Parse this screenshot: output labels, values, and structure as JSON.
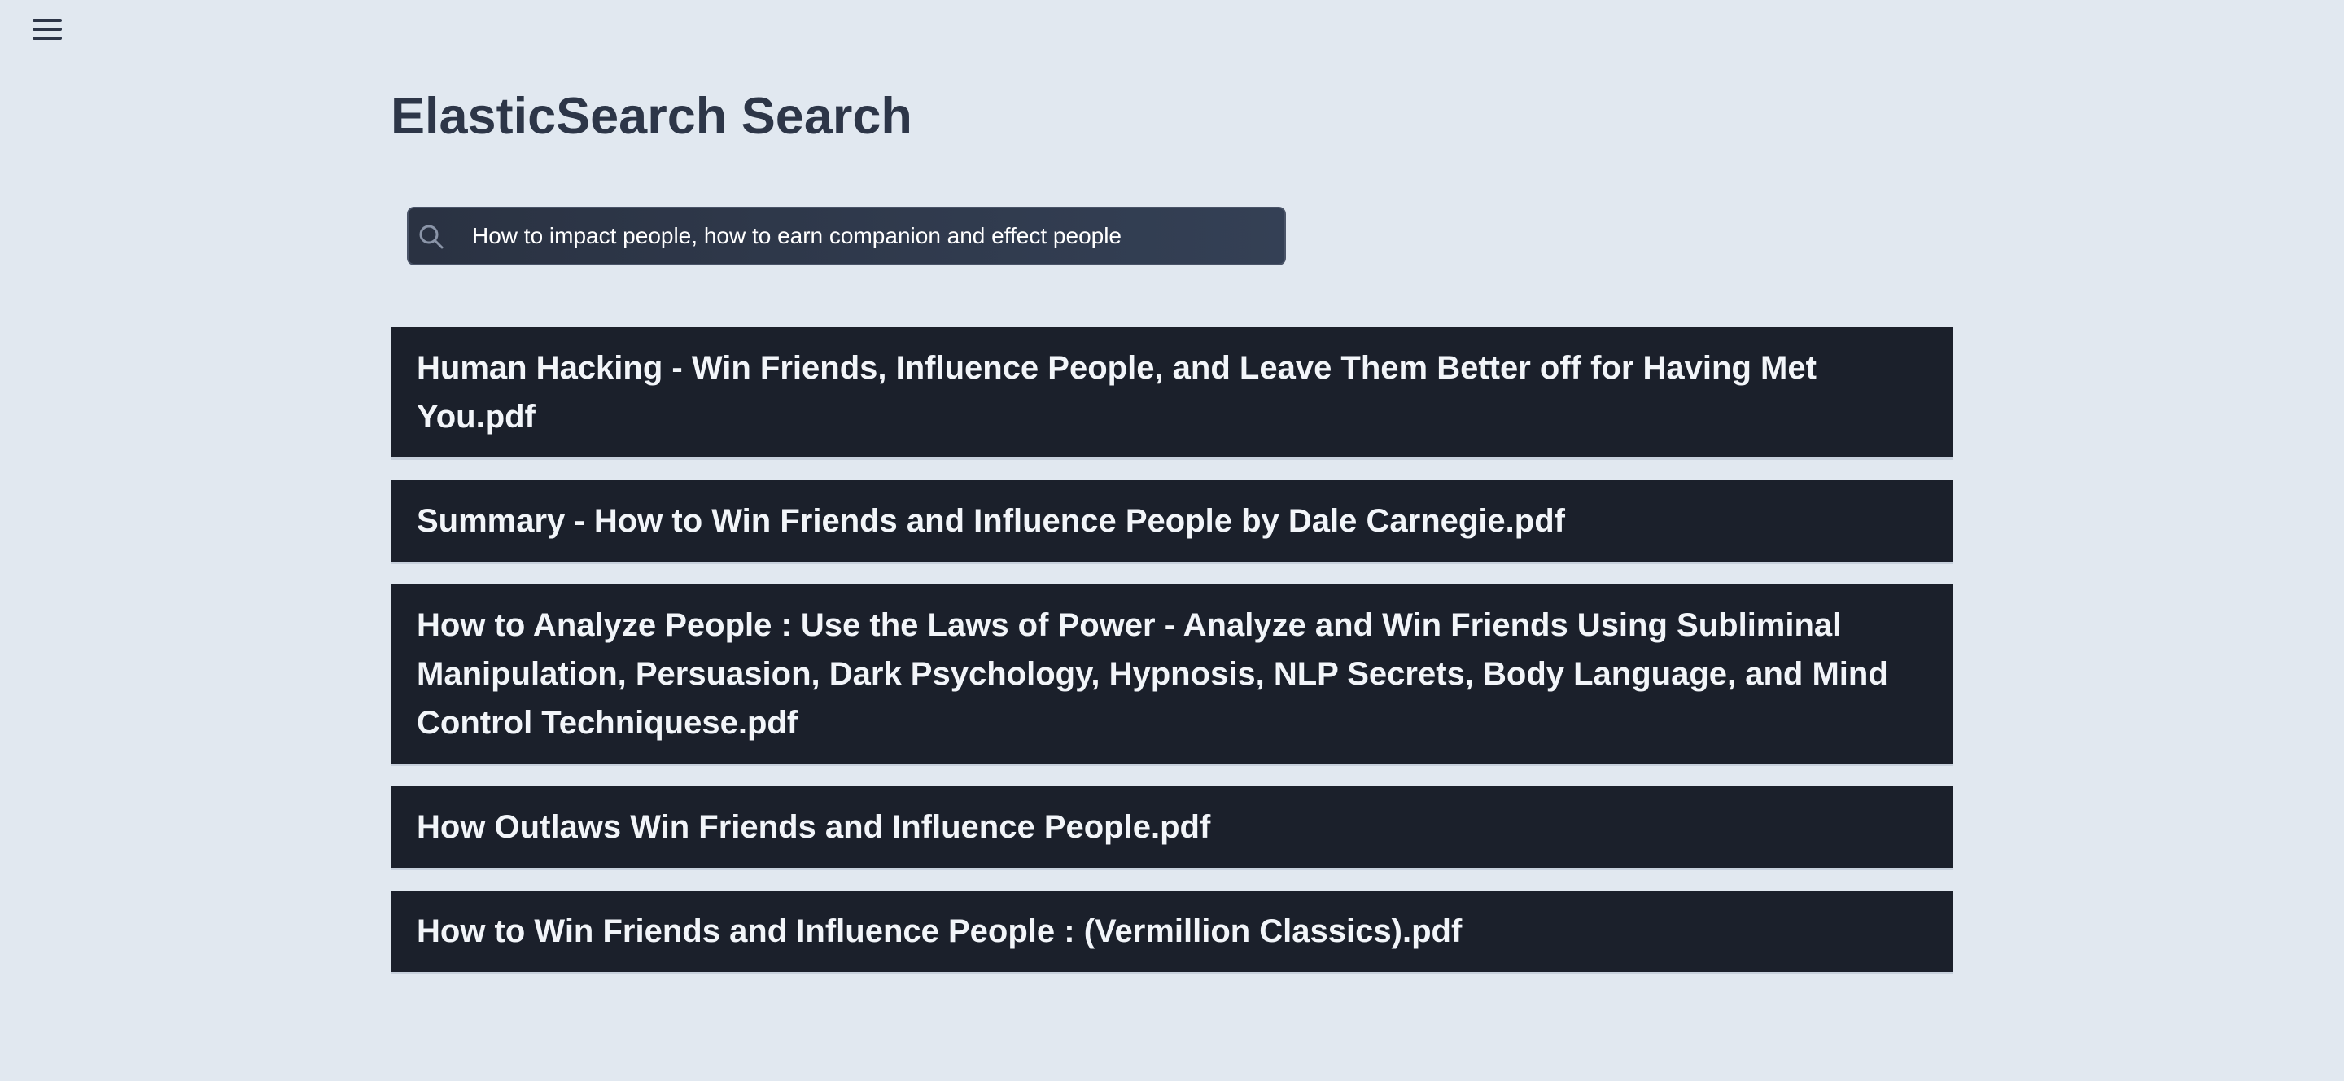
{
  "nav": {
    "menu_icon": "hamburger-menu-icon"
  },
  "header": {
    "title": "ElasticSearch Search"
  },
  "search": {
    "icon": "search-icon",
    "value": "How to impact people, how to earn companion and effect people"
  },
  "results": [
    {
      "title": "Human Hacking - Win Friends, Influence People, and Leave Them Better off for Having Met You.pdf"
    },
    {
      "title": "Summary - How to Win Friends and Influence People by Dale Carnegie.pdf"
    },
    {
      "title": "How to Analyze People : Use the Laws of Power - Analyze and Win Friends Using Subliminal Manipulation, Persuasion, Dark Psychology, Hypnosis, NLP Secrets, Body Language, and Mind Control Techniquese.pdf"
    },
    {
      "title": "How Outlaws Win Friends and Influence People.pdf"
    },
    {
      "title": "How to Win Friends and Influence People : (Vermillion Classics).pdf"
    }
  ],
  "colors": {
    "background": "#e1e8f0",
    "title_text": "#2d3648",
    "result_bg": "#1b202b",
    "result_text": "#f2f5f9",
    "search_bg": "#2a3242"
  }
}
